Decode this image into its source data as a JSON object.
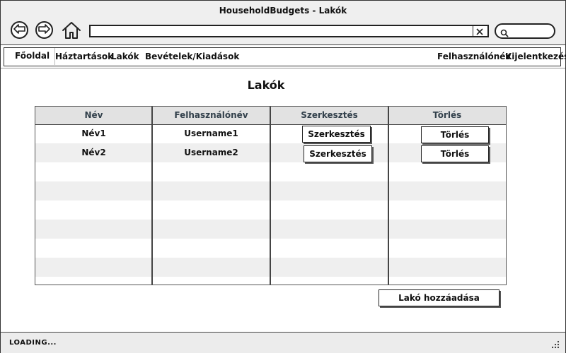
{
  "window": {
    "title": "HouseholdBudgets - Lakók"
  },
  "toolbar": {
    "back_icon": "arrow-left-icon",
    "forward_icon": "arrow-right-icon",
    "home_icon": "home-icon",
    "address_value": "",
    "clear_icon": "close-icon",
    "search_icon": "search-icon",
    "search_value": ""
  },
  "menu": {
    "items": [
      {
        "label": "Főoldal"
      },
      {
        "label": "Háztartások"
      },
      {
        "label": "Lakók"
      },
      {
        "label": "Bevételek/Kiadások"
      },
      {
        "label": "Felhasználónév"
      },
      {
        "label": "Kijelentkezés"
      }
    ]
  },
  "main": {
    "title": "Lakók",
    "table": {
      "columns": [
        "Név",
        "Felhasználónév",
        "Szerkesztés",
        "Törlés"
      ],
      "rows": [
        {
          "name": "Név1",
          "username": "Username1",
          "edit_label": "Szerkesztés",
          "delete_label": "Törlés"
        },
        {
          "name": "Név2",
          "username": "Username2",
          "edit_label": "Szerkesztés",
          "delete_label": "Törlés"
        }
      ]
    },
    "add_button": "Lakó hozzáadása"
  },
  "status": {
    "text": "LOADING..."
  },
  "colors": {
    "header_text": "#33414c",
    "stripe": "#efefef",
    "header_bg": "#e2e2e2"
  }
}
